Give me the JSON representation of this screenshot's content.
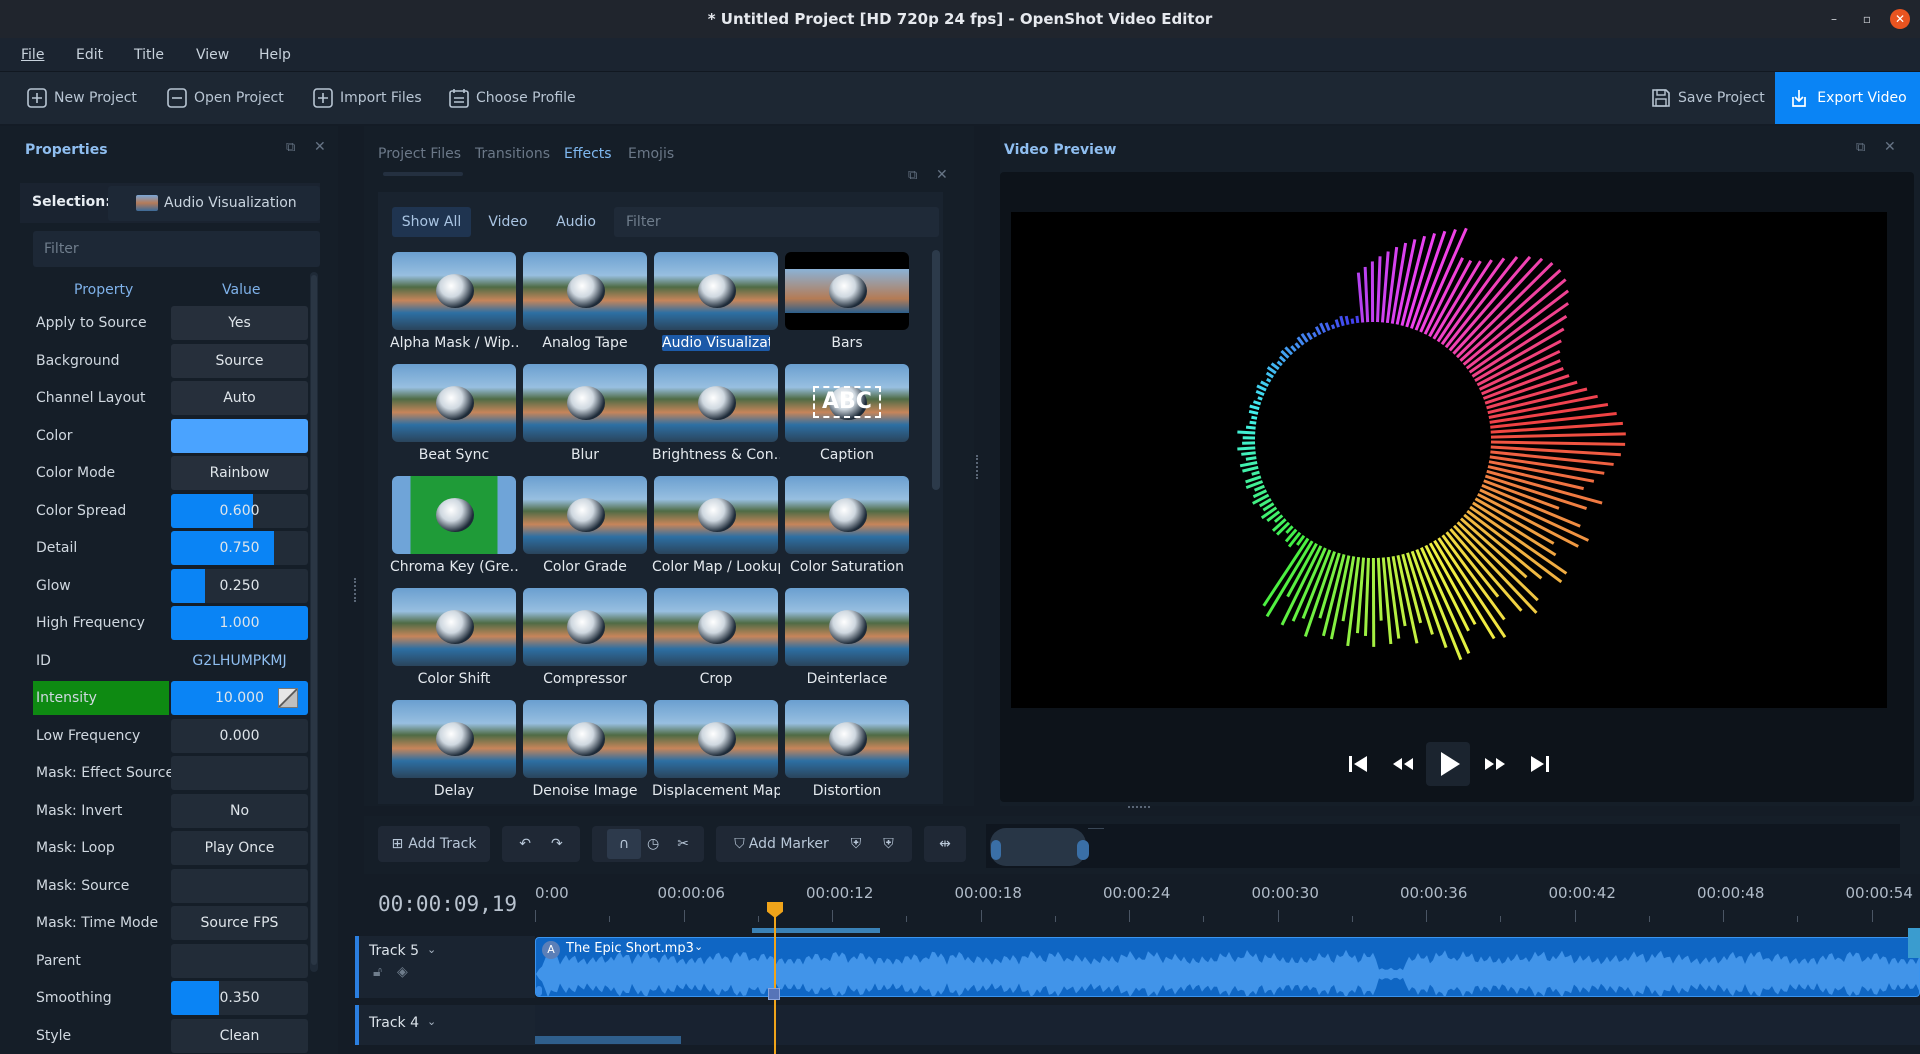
{
  "window": {
    "title": "* Untitled Project [HD 720p 24 fps] - OpenShot Video Editor",
    "minimize": "–",
    "maximize": "▫",
    "close": "✕"
  },
  "menu": [
    "File",
    "Edit",
    "Title",
    "View",
    "Help"
  ],
  "toolbar": {
    "new_project": "New Project",
    "open_project": "Open Project",
    "import_files": "Import Files",
    "choose_profile": "Choose Profile",
    "save_project": "Save Project",
    "export_video": "Export Video"
  },
  "properties": {
    "title": "Properties",
    "selection_label": "Selection:",
    "selection_value": "Audio Visualization",
    "filter_placeholder": "Filter",
    "col_property": "Property",
    "col_value": "Value",
    "rows": [
      {
        "name": "Apply to Source",
        "value": "Yes"
      },
      {
        "name": "Background",
        "value": "Source"
      },
      {
        "name": "Channel Layout",
        "value": "Auto"
      },
      {
        "name": "Color",
        "value": ""
      },
      {
        "name": "Color Mode",
        "value": "Rainbow"
      },
      {
        "name": "Color Spread",
        "value": "0.600"
      },
      {
        "name": "Detail",
        "value": "0.750"
      },
      {
        "name": "Glow",
        "value": "0.250"
      },
      {
        "name": "High Frequency",
        "value": "1.000"
      },
      {
        "name": "ID",
        "value": "G2LHUMPKMJ"
      },
      {
        "name": "Intensity",
        "value": "10.000"
      },
      {
        "name": "Low Frequency",
        "value": "0.000"
      },
      {
        "name": "Mask: Effect Source",
        "value": ""
      },
      {
        "name": "Mask: Invert",
        "value": "No"
      },
      {
        "name": "Mask: Loop",
        "value": "Play Once"
      },
      {
        "name": "Mask: Source",
        "value": ""
      },
      {
        "name": "Mask: Time Mode",
        "value": "Source FPS"
      },
      {
        "name": "Parent",
        "value": ""
      },
      {
        "name": "Smoothing",
        "value": "0.350"
      },
      {
        "name": "Style",
        "value": "Clean"
      }
    ],
    "levels": {
      "Color Spread": 0.6,
      "Detail": 0.75,
      "Glow": 0.25,
      "High Frequency": 1.0,
      "Intensity": 1.0,
      "Smoothing": 0.35
    },
    "color_value": "#4aa3ff",
    "intensity_highlight": "#0e8a12"
  },
  "effects_panel": {
    "tabs": [
      "Project Files",
      "Transitions",
      "Effects",
      "Emojis"
    ],
    "active_tab": "Effects",
    "filters": [
      "Show All",
      "Video",
      "Audio"
    ],
    "filter_placeholder": "Filter",
    "items": [
      "Alpha Mask / Wip…",
      "Analog Tape",
      "Audio Visualization",
      "Bars",
      "Beat Sync",
      "Blur",
      "Brightness & Con…",
      "Caption",
      "Chroma Key (Gre…",
      "Color Grade",
      "Color Map / Lookup",
      "Color Saturation",
      "Color Shift",
      "Compressor",
      "Crop",
      "Deinterlace",
      "Delay",
      "Denoise Image",
      "Displacement Map",
      "Distortion"
    ],
    "selected": "Audio Visualization",
    "caption_text": "ABC"
  },
  "preview": {
    "title": "Video Preview"
  },
  "timeline_toolbar": {
    "add_track": "Add Track",
    "add_marker": "Add Marker"
  },
  "timeline": {
    "timecode": "00:00:09,19",
    "ticks": [
      "0:00",
      "00:00:06",
      "00:00:12",
      "00:00:18",
      "00:00:24",
      "00:00:30",
      "00:00:36",
      "00:00:42",
      "00:00:48",
      "00:00:54"
    ],
    "tracks": [
      {
        "name": "Track 5",
        "clip": "The Epic Short.mp3",
        "badge": "A"
      },
      {
        "name": "Track 4"
      }
    ]
  },
  "colors": {
    "accent": "#0a84f5",
    "playhead": "#f0a41a",
    "clip": "#0f66c4"
  }
}
